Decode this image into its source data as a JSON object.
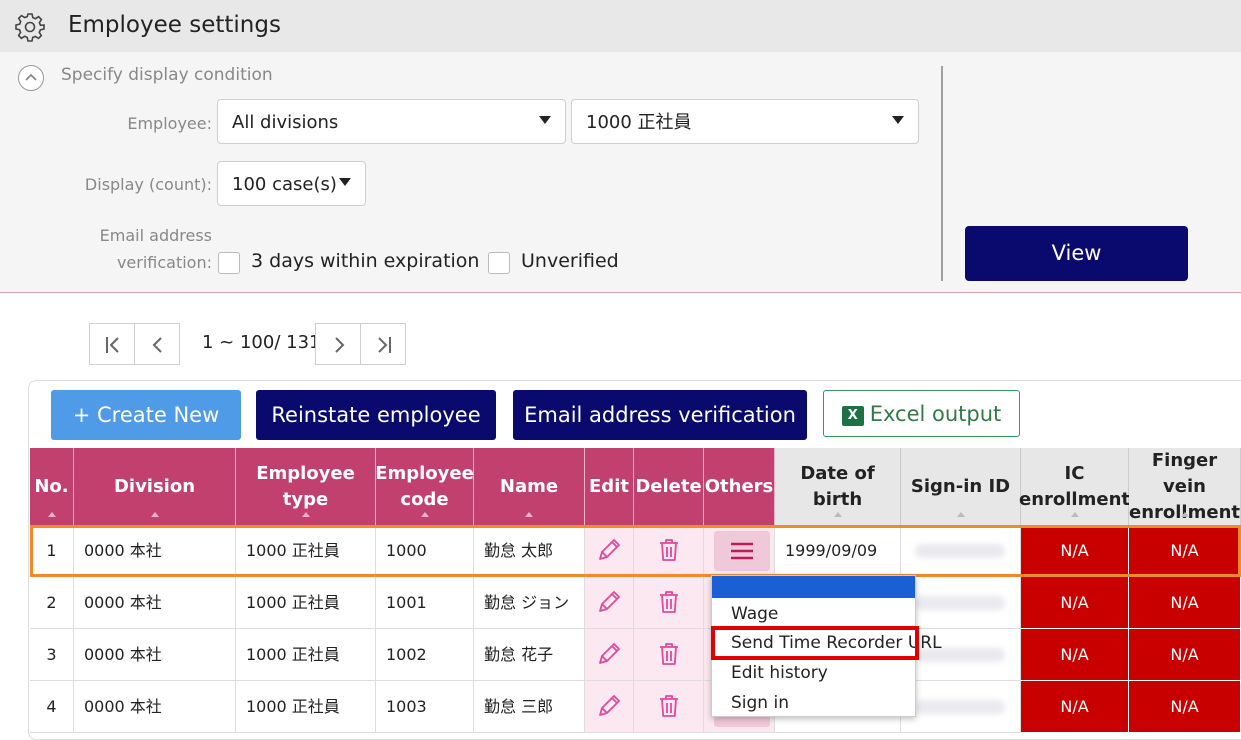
{
  "header": {
    "title": "Employee settings",
    "icon": "gear-icon"
  },
  "condition": {
    "title": "Specify display condition",
    "employee_label": "Employee:",
    "division_select": "All divisions",
    "type_select": "1000 正社員",
    "display_label": "Display (count):",
    "count_select": "100 case(s)",
    "email_label_1": "Email address",
    "email_label_2": "verification:",
    "chk_expiration": "3 days within expiration",
    "chk_unverified": "Unverified",
    "view_button": "View"
  },
  "pager": {
    "text": "1 ~ 100/ 131"
  },
  "toolbar": {
    "create": "+ Create New",
    "reinstate": "Reinstate employee",
    "email_verify": "Email address verification",
    "excel": "Excel output"
  },
  "table": {
    "headers": {
      "no": "No.",
      "division": "Division",
      "type": "Employee type",
      "code_1": "Employee",
      "code_2": "code",
      "name": "Name",
      "edit": "Edit",
      "delete": "Delete",
      "others": "Others",
      "dob": "Date of birth",
      "signin": "Sign-in ID",
      "ic_1": "IC",
      "ic_2": "enrollment",
      "fv_1": "Finger vein",
      "fv_2": "enrollment"
    },
    "rows": [
      {
        "no": "1",
        "division": "0000 本社",
        "type": "1000 正社員",
        "code": "1000",
        "name": "勤怠 太郎",
        "dob": "1999/09/09",
        "ic": "N/A",
        "fv": "N/A"
      },
      {
        "no": "2",
        "division": "0000 本社",
        "type": "1000 正社員",
        "code": "1001",
        "name": "勤怠 ジョン",
        "dob": "",
        "ic": "N/A",
        "fv": "N/A"
      },
      {
        "no": "3",
        "division": "0000 本社",
        "type": "1000 正社員",
        "code": "1002",
        "name": "勤怠 花子",
        "dob": "",
        "ic": "N/A",
        "fv": "N/A"
      },
      {
        "no": "4",
        "division": "0000 本社",
        "type": "1000 正社員",
        "code": "1003",
        "name": "勤怠 三郎",
        "dob": "",
        "ic": "N/A",
        "fv": "N/A"
      }
    ]
  },
  "others_menu": {
    "items": [
      "Wage",
      "Send Time Recorder URL",
      "Edit history",
      "Sign in"
    ]
  },
  "colors": {
    "header_pink": "#c2406e",
    "navy": "#0a0a6e",
    "na_red": "#c80000",
    "create_blue": "#4f9be8",
    "selection_orange": "#f08a2c",
    "highlight_red": "#e00000"
  }
}
